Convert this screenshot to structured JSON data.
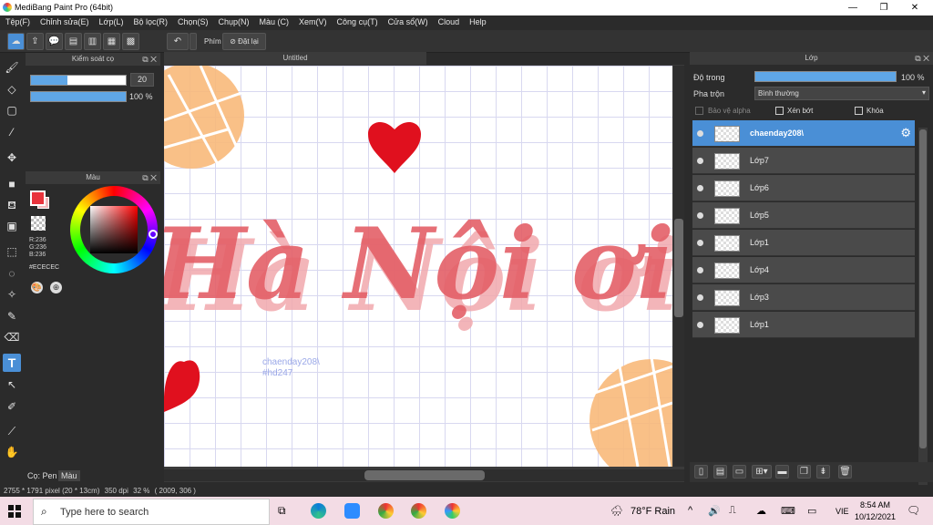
{
  "window": {
    "title": "MediBang Paint Pro (64bit)"
  },
  "menu": [
    "Tệp(F)",
    "Chỉnh sửa(E)",
    "Lớp(L)",
    "Bộ lọc(R)",
    "Chọn(S)",
    "Chụp(N)",
    "Màu (C)",
    "Xem(V)",
    "Công cụ(T)",
    "Cửa sổ(W)",
    "Cloud",
    "Help"
  ],
  "toolbar": {
    "shortcut_label": "Phím",
    "reset_label": "Đặt lại"
  },
  "brush_panel": {
    "title": "Kiểm soát cọ",
    "size_value": "20",
    "size_fraction": 0.38,
    "opacity_label": "100 %",
    "opacity_fraction": 1.0
  },
  "color_panel": {
    "title": "Màu",
    "r": "R:236",
    "g": "G:236",
    "b": "B:236",
    "hex": "#ECECEC",
    "primary_color": "#e8333c"
  },
  "bottom_tabs": {
    "brush": "Cọ: Pen",
    "color": "Màu"
  },
  "canvas": {
    "tab_title": "Untitled",
    "text_main": "Hà Nội ơi",
    "watermark_line1": "chaenday208\\",
    "watermark_line2": "#hd247"
  },
  "layers_panel": {
    "title": "Lớp",
    "opacity_label": "Độ trong",
    "opacity_value": "100 %",
    "opacity_fraction": 1.0,
    "blend_label": "Pha trộn",
    "blend_value": "Bình thường",
    "protect_alpha": "Bảo vệ alpha",
    "clipping": "Xén bớt",
    "lock": "Khóa",
    "layers": [
      {
        "name": "chaenday208\\",
        "selected": true
      },
      {
        "name": "Lớp7"
      },
      {
        "name": "Lớp6"
      },
      {
        "name": "Lớp5"
      },
      {
        "name": "Lớp1"
      },
      {
        "name": "Lớp4"
      },
      {
        "name": "Lớp3"
      },
      {
        "name": "Lớp1"
      }
    ]
  },
  "status": {
    "size": "2755 * 1791 pixel",
    "cm": "(20 * 13cm)",
    "dpi": "350 dpi",
    "zoom": "32 %",
    "coords": "( 2009, 306 )"
  },
  "taskbar": {
    "search_placeholder": "Type here to search",
    "weather": "78°F  Rain",
    "lang": "VIE",
    "time": "8:54 AM",
    "date": "10/12/2021"
  }
}
